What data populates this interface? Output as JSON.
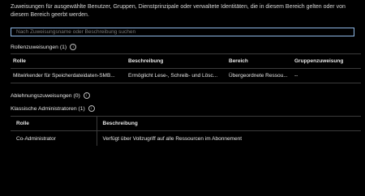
{
  "intro_text": "Zuweisungen für ausgewählte Benutzer, Gruppen, Dienstprinzipale oder verwaltete Identitäten, die in diesem Bereich gelten oder von diesem Bereich geerbt werden.",
  "search": {
    "placeholder": "Nach Zuweisungsname oder Beschreibung suchen",
    "value": ""
  },
  "role_assignments": {
    "title": "Rollenzuweisungen (1)",
    "columns": [
      "Rolle",
      "Beschreibung",
      "Bereich",
      "Gruppenzuweisung"
    ],
    "rows": [
      {
        "role": "Mitwirkender für Speicherdateidaten-SMB...",
        "description": "Ermöglicht Lese-, Schreib- und Lösc...",
        "scope": "Übergeordnete Ressou...",
        "group": "--"
      }
    ]
  },
  "deny_assignments": {
    "title": "Ablehnungszuweisungen (0)"
  },
  "classic_admins": {
    "title": "Klassische Administratoren (1)",
    "columns": [
      "Rolle",
      "Beschreibung"
    ],
    "rows": [
      {
        "role": "Co-Administrator",
        "description": "Verfügt über Vollzugriff auf alle Ressourcen im Abonnement"
      }
    ]
  },
  "colors": {
    "background": "#000000",
    "link": "#4ba0f0",
    "search_border": "#8fb8e6",
    "divider": "#3b3b3b"
  }
}
